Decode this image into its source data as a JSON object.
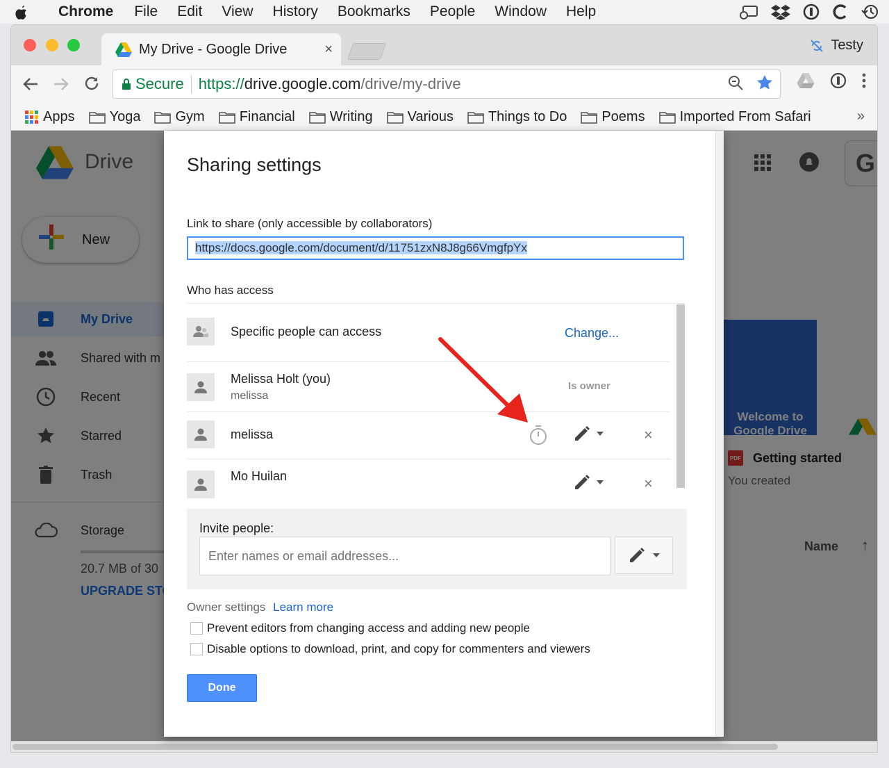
{
  "menubar": {
    "app": "Chrome",
    "items": [
      "File",
      "Edit",
      "View",
      "History",
      "Bookmarks",
      "People",
      "Window",
      "Help"
    ]
  },
  "tab": {
    "title": "My Drive - Google Drive",
    "close": "×"
  },
  "profile": {
    "name": "Testy"
  },
  "address": {
    "secure": "Secure",
    "scheme": "https://",
    "host": "drive.google.com",
    "path": "/drive/my-drive"
  },
  "bookmarks": {
    "apps": "Apps",
    "folders": [
      "Yoga",
      "Gym",
      "Financial",
      "Writing",
      "Various",
      "Things to Do",
      "Poems",
      "Imported From Safari"
    ],
    "more": "»"
  },
  "drive": {
    "logo_text": "Drive",
    "new_button": "New",
    "nav": [
      "My Drive",
      "Shared with m",
      "Recent",
      "Starred",
      "Trash"
    ],
    "storage_label": "Storage",
    "storage_text": "20.7 MB of 30",
    "upgrade": "UPGRADE STO",
    "avatar_letter": "G",
    "welcome": "Welcome to Google Drive",
    "file_name": "Getting started",
    "file_badge": "PDF",
    "file_sub": "You created",
    "sort_col": "Name",
    "sort_arrow": "↑"
  },
  "dialog": {
    "title": "Sharing settings",
    "link_label": "Link to share (only accessible by collaborators)",
    "link_value": "https://docs.google.com/document/d/11751zxN8J8g66VmgfpYx",
    "who_label": "Who has access",
    "access_rows": [
      {
        "name": "Specific people can access",
        "action": "Change..."
      },
      {
        "name": "Melissa Holt (you)",
        "sub": "melissa",
        "role": "Is owner"
      },
      {
        "name": "melissa"
      },
      {
        "name": "Mo Huilan"
      }
    ],
    "invite_label": "Invite people:",
    "invite_placeholder": "Enter names or email addresses...",
    "owner_settings": "Owner settings",
    "learn_more": "Learn more",
    "options": [
      "Prevent editors from changing access and adding new people",
      "Disable options to download, print, and copy for commenters and viewers"
    ],
    "done": "Done",
    "remove": "×"
  }
}
